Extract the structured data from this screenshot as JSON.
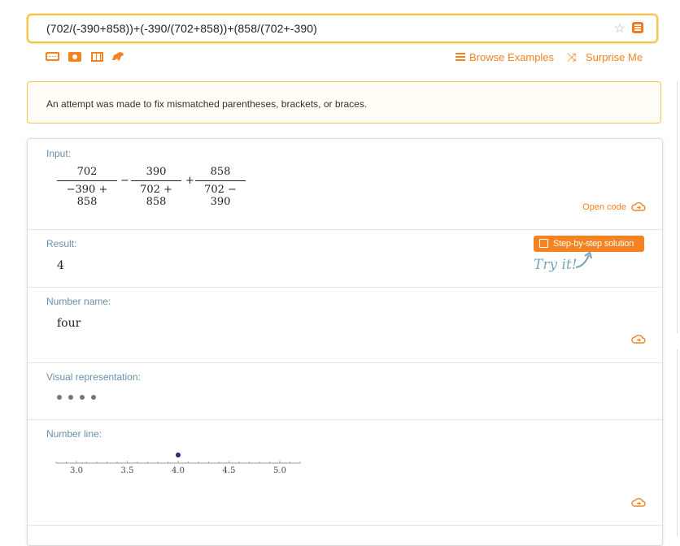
{
  "search": {
    "query": "(702/(-390+858))+(-390/(702+858))+(858/(702+-390)"
  },
  "toolbar": {
    "icons": [
      "keyboard-icon",
      "camera-icon",
      "table-icon",
      "dinosaur-icon"
    ],
    "browse_label": "Browse Examples",
    "surprise_label": "Surprise Me"
  },
  "notice": {
    "text": "An attempt was made to fix mismatched parentheses, brackets, or braces."
  },
  "pods": {
    "input": {
      "title": "Input:",
      "fractions": [
        {
          "num": "702",
          "den": "−390 + 858"
        },
        {
          "num": "390",
          "den": "702 + 858"
        },
        {
          "num": "858",
          "den": "702 − 390"
        }
      ],
      "ops": [
        "−",
        "+"
      ],
      "open_code": "Open code"
    },
    "result": {
      "title": "Result:",
      "value": "4",
      "step_button": "Step-by-step solution",
      "try_it": "Try it!"
    },
    "number_name": {
      "title": "Number name:",
      "value": "four"
    },
    "visual": {
      "title": "Visual representation:",
      "count": 4
    },
    "number_line": {
      "title": "Number line:",
      "ticks": [
        "3.0",
        "3.5",
        "4.0",
        "4.5",
        "5.0"
      ],
      "point": 4.0,
      "range": [
        2.8,
        5.2
      ]
    }
  },
  "colors": {
    "accent": "#f58220",
    "pod_title": "#6a8faa",
    "border": "#f6c453"
  }
}
